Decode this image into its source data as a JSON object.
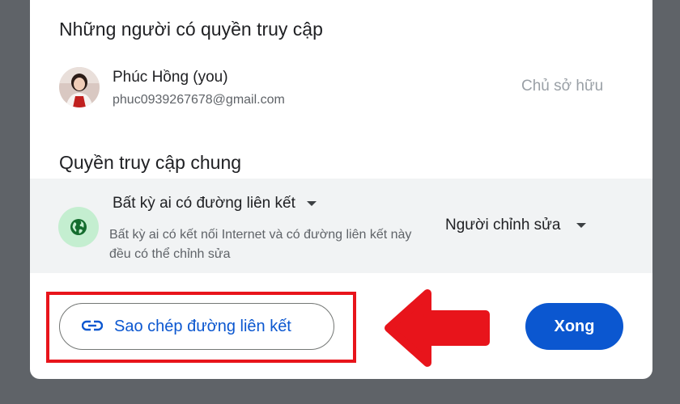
{
  "access_section": {
    "title": "Những người có quyền truy cập",
    "user": {
      "name": "Phúc Hồng (you)",
      "email": "phuc0939267678@gmail.com",
      "role": "Chủ sở hữu"
    }
  },
  "general_access": {
    "title": "Quyền truy cập chung",
    "link_type": "Bất kỳ ai có đường liên kết",
    "description": "Bất kỳ ai có kết nối Internet và có đường liên kết này đều có thể chỉnh sửa",
    "role": "Người chỉnh sửa",
    "icon": "globe-icon"
  },
  "footer": {
    "copy_link_label": "Sao chép đường liên kết",
    "done_label": "Xong"
  },
  "colors": {
    "primary": "#0b57d0",
    "highlight": "#e8141b",
    "globe_badge": "#c4eed0"
  }
}
